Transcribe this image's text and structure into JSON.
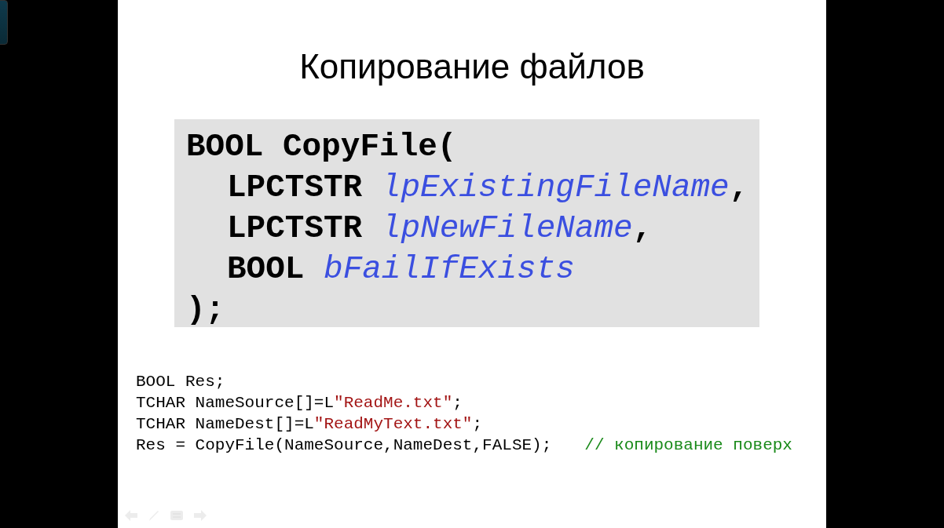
{
  "slide": {
    "title": "Копирование файлов",
    "signature": [
      {
        "tokens": [
          {
            "kind": "text",
            "text": "BOOL CopyFile("
          }
        ],
        "children": [
          {
            "tokens": [
              {
                "kind": "text",
                "text": "LPCTSTR "
              },
              {
                "kind": "param",
                "text": "lpExistingFileName"
              },
              {
                "kind": "text",
                "text": ","
              }
            ]
          },
          {
            "tokens": [
              {
                "kind": "text",
                "text": "LPCTSTR "
              },
              {
                "kind": "param",
                "text": "lpNewFileName"
              },
              {
                "kind": "text",
                "text": ","
              }
            ]
          },
          {
            "tokens": [
              {
                "kind": "text",
                "text": "BOOL "
              },
              {
                "kind": "param",
                "text": "bFailIfExists"
              }
            ]
          }
        ]
      },
      {
        "tokens": [
          {
            "kind": "text",
            "text": ");"
          }
        ]
      }
    ],
    "example": [
      {
        "tokens": [
          {
            "kind": "text",
            "text": "BOOL Res;"
          }
        ]
      },
      {
        "tokens": [
          {
            "kind": "text",
            "text": "TCHAR NameSource[]=L"
          },
          {
            "kind": "string",
            "text": "\"ReadMe.txt\""
          },
          {
            "kind": "text",
            "text": ";"
          }
        ]
      },
      {
        "tokens": [
          {
            "kind": "text",
            "text": "TCHAR NameDest[]=L"
          },
          {
            "kind": "string",
            "text": "\"ReadMyText.txt\""
          },
          {
            "kind": "text",
            "text": ";"
          }
        ]
      },
      {
        "tokens": [
          {
            "kind": "text",
            "text": "Res = CopyFile(NameSource,NameDest,FALSE);"
          },
          {
            "kind": "comment",
            "text": "// копирование поверх"
          }
        ]
      }
    ]
  }
}
